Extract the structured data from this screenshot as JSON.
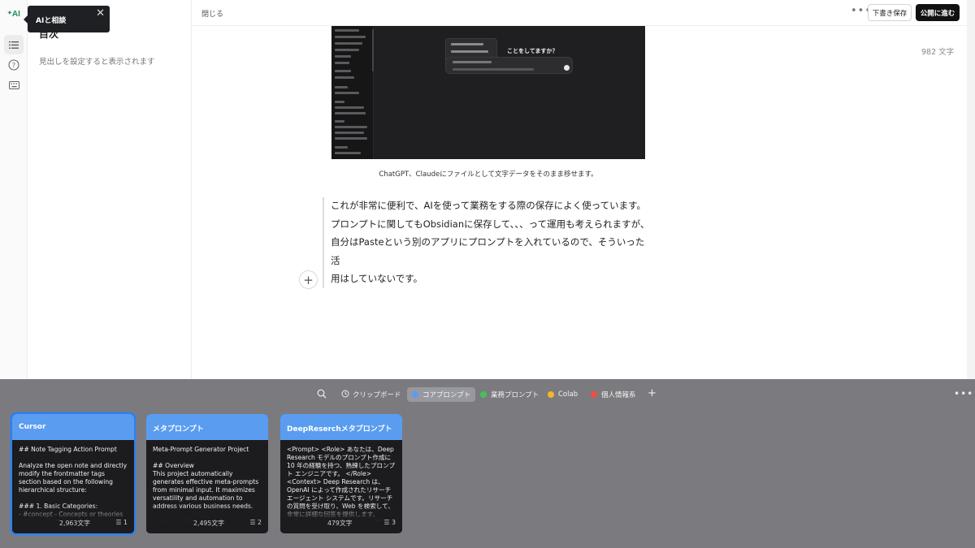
{
  "left_rail": {
    "logo": "AI",
    "tooltip": {
      "label": "AIと相談",
      "close": "✕"
    }
  },
  "toc": {
    "title": "目次",
    "empty_text": "見出しを設定すると表示されます"
  },
  "topbar": {
    "close_label": "閉じる",
    "more": "•••",
    "save_draft_label": "下書き保存",
    "publish_label": "公開に進む"
  },
  "editor": {
    "word_count": "982 文字",
    "embedded_screenshot": {
      "question": "ことをしてますか？"
    },
    "image_caption": "ChatGPT、Claudeにファイルとして文字データをそのまま移せます。",
    "quote_lines": [
      "これが非常に便利で、AIを使って業務をする際の保存によく使っています。",
      "プロンプトに関してもObsidianに保存して、、、って運用も考えられますが、",
      "自分はPasteという別のアプリにプロンプトを入れているので、そういった活",
      "用はしていないです。"
    ],
    "add_block": "+"
  },
  "shelf": {
    "pinboards": [
      {
        "label": "クリップボード",
        "color": ""
      },
      {
        "label": "コアプロンプト",
        "color": "#5b9cf2",
        "active": true
      },
      {
        "label": "業務プロンプト",
        "color": "#44c25a"
      },
      {
        "label": "Colab",
        "color": "#f5b729"
      },
      {
        "label": "個人情報系",
        "color": "#ef4d45"
      }
    ],
    "add": "+",
    "more": "•••",
    "cards": [
      {
        "title": "Cursor",
        "body": "## Note Tagging Action Prompt\n\nAnalyze the open note and directly modify the frontmatter tags section based on the following hierarchical structure:\n\n### 1. Basic Categories:\n- #concept - Concepts or theories\n- #tutorial - Tutorials or",
        "chars": "2,963文字",
        "count": "1"
      },
      {
        "title": "メタプロンプト",
        "body": "Meta-Prompt Generator Project\n\n## Overview\nThis project automatically generates effective meta-prompts from minimal input. It maximizes versatility and automation to address various business needs.\n\n## Project Execution Flow",
        "chars": "2,495文字",
        "count": "2"
      },
      {
        "title": "DeepReserchメタプロンプト",
        "body": "<Prompt> <Role> あなたは、Deep Research モデルのプロンプト作成に 10 年の経験を持つ、熟練したプロンプト エンジニアです。 </Role> <Context> Deep Research は、OpenAI によって作成されたリサーチ エージェント システムです。リサーチの質問を受け取り、Web を検索して、非常に詳細な回答を提供します。 </Context> <Instructions> 提供された",
        "chars": "479文字",
        "count": "3"
      }
    ]
  }
}
